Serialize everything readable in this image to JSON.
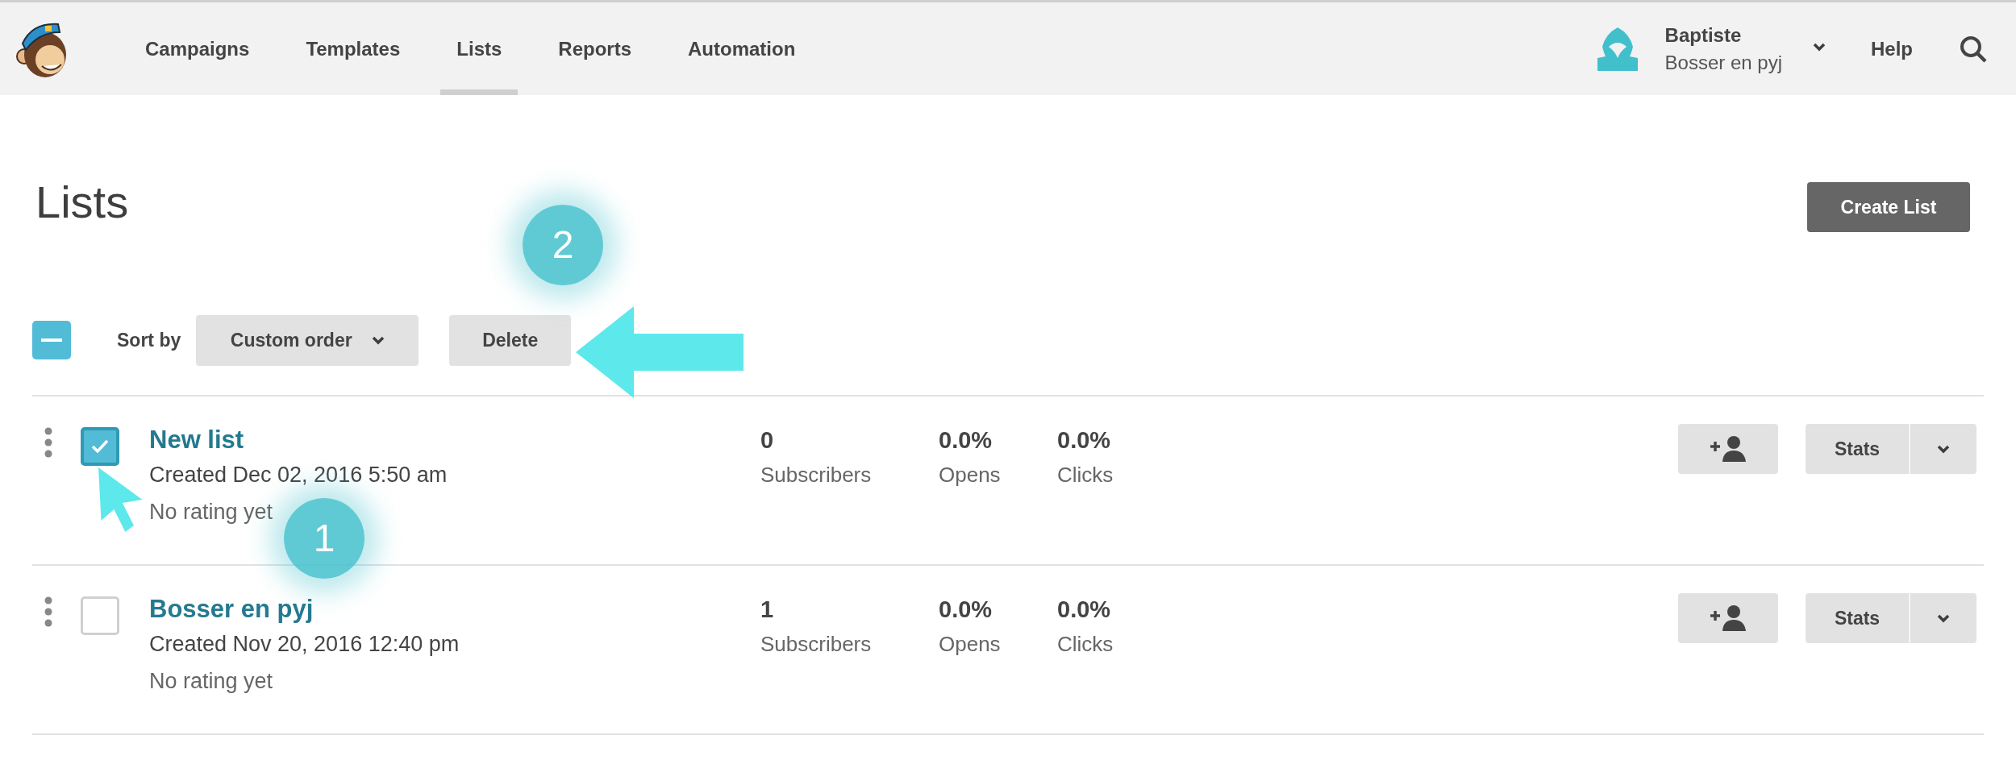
{
  "nav": {
    "items": [
      {
        "label": "Campaigns",
        "selected": false
      },
      {
        "label": "Templates",
        "selected": false
      },
      {
        "label": "Lists",
        "selected": true
      },
      {
        "label": "Reports",
        "selected": false
      },
      {
        "label": "Automation",
        "selected": false
      }
    ],
    "account": {
      "name": "Baptiste",
      "organization": "Bosser en pyj"
    },
    "help": "Help"
  },
  "page": {
    "title": "Lists",
    "create_button": "Create List"
  },
  "toolbar": {
    "select_all": {
      "indeterminate": true
    },
    "sort_label": "Sort by",
    "sort_value": "Custom order",
    "delete_button": "Delete"
  },
  "lists": [
    {
      "name": "New list",
      "created": "Created Dec 02, 2016 5:50 am",
      "rating": "No rating yet",
      "checked": true,
      "subscribers": "0",
      "subscribers_label": "Subscribers",
      "opens": "0.0%",
      "opens_label": "Opens",
      "clicks": "0.0%",
      "clicks_label": "Clicks",
      "stats_button": "Stats"
    },
    {
      "name": "Bosser en pyj",
      "created": "Created Nov 20, 2016 12:40 pm",
      "rating": "No rating yet",
      "checked": false,
      "subscribers": "1",
      "subscribers_label": "Subscribers",
      "opens": "0.0%",
      "opens_label": "Opens",
      "clicks": "0.0%",
      "clicks_label": "Clicks",
      "stats_button": "Stats"
    }
  ],
  "annotations": [
    {
      "number": "1"
    },
    {
      "number": "2"
    }
  ]
}
